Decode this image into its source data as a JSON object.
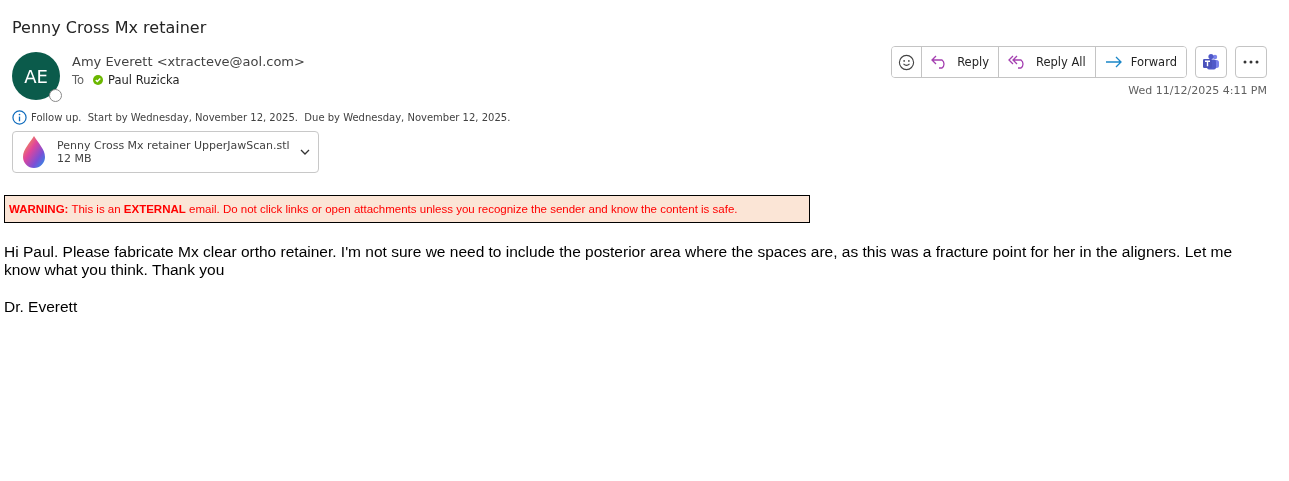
{
  "subject": "Penny Cross Mx retainer",
  "sender": {
    "initials": "AE",
    "name": "Amy Everett <xtracteve@aol.com>"
  },
  "to": {
    "label": "To",
    "recipient": "Paul Ruzicka"
  },
  "actions": [
    {
      "kind": "emoji"
    },
    {
      "kind": "reply",
      "label": "Reply"
    },
    {
      "kind": "reply-all",
      "label": "Reply All"
    },
    {
      "kind": "forward",
      "label": "Forward"
    }
  ],
  "date": "Wed 11/12/2025 4:11 PM",
  "follow_up": "Follow up.  Start by Wednesday, November 12, 2025.  Due by Wednesday, November 12, 2025.",
  "attachment": {
    "name": "Penny Cross Mx retainer UpperJawScan.stl",
    "size": "12 MB"
  },
  "warning": "**WARNING:** This is an **EXTERNAL** email. Do not click links or open attachments unless you recognize the sender and know the content is safe.",
  "body": [
    "Hi Paul. Please fabricate Mx clear ortho retainer. I'm not sure we need to include the posterior area where the spaces are, as this was a fracture point for her in the aligners. Let me know what you think. Thank you",
    "Dr. Everett"
  ]
}
